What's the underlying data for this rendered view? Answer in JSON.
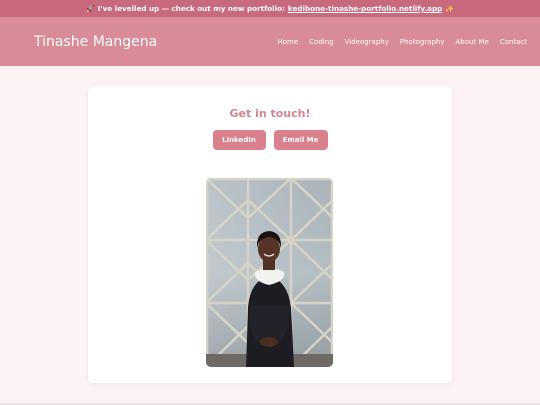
{
  "banner": {
    "rocket_icon": "🚀",
    "text": "I've levelled up — check out my new portfolio:",
    "link": "kedibone-tinashe-portfolio.netlify.app",
    "sparkle_icon": "✨"
  },
  "navbar": {
    "brand": "Tinashe Mangena",
    "items": [
      {
        "label": "Home"
      },
      {
        "label": "Coding"
      },
      {
        "label": "Videography"
      },
      {
        "label": "Photography"
      },
      {
        "label": "About Me"
      },
      {
        "label": "Contact"
      }
    ]
  },
  "contact": {
    "title": "Get in touch!",
    "linkedin_label": "LinkedIn",
    "email_label": "Email Me"
  },
  "colors": {
    "banner": "#c9697d",
    "navbar": "#d98c97",
    "accent": "#d9808c",
    "background": "#fdf3f5"
  }
}
